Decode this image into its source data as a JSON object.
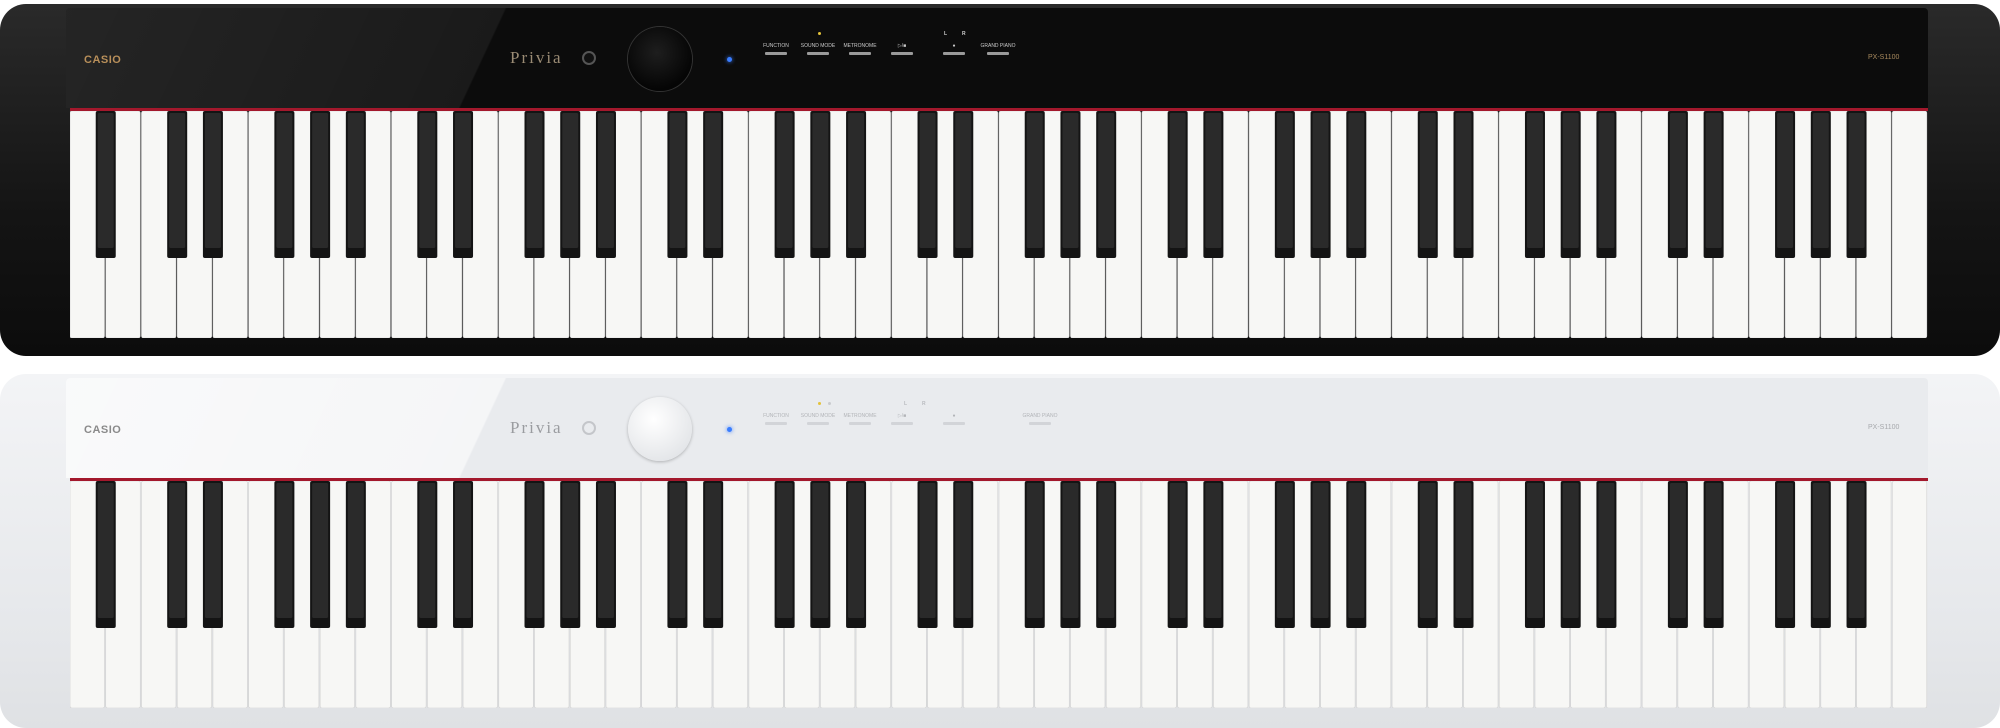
{
  "pianos": [
    {
      "variant": "black",
      "brand": "CASIO",
      "series": "Privia",
      "model": "PX-S1100",
      "buttons": [
        "FUNCTION",
        "SOUND MODE",
        "METRONOME",
        "▷/■",
        "●",
        "GRAND PIANO"
      ],
      "channel_labels": [
        "L",
        "R"
      ],
      "colors": {
        "body": "#141414",
        "accent": "#a3182c",
        "led": "#3a7dff"
      }
    },
    {
      "variant": "white",
      "brand": "CASIO",
      "series": "Privia",
      "model": "PX-S1100",
      "buttons": [
        "FUNCTION",
        "SOUND MODE",
        "METRONOME",
        "▷/■",
        "●",
        "GRAND PIANO"
      ],
      "channel_labels": [
        "L",
        "R"
      ],
      "colors": {
        "body": "#e6e8eb",
        "accent": "#a3182c",
        "led": "#3a7dff"
      }
    }
  ],
  "keyboard": {
    "white_keys": 52,
    "black_keys": 36,
    "total_keys": 88
  }
}
